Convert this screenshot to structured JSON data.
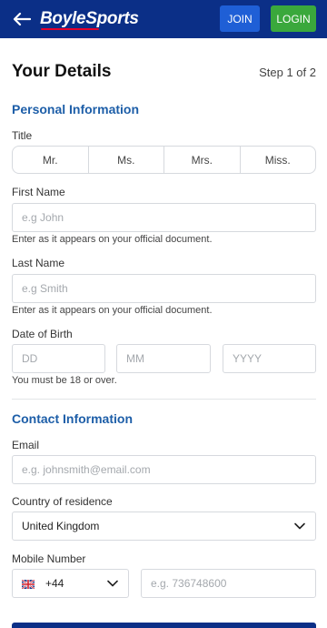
{
  "header": {
    "brand": "BoyleSports",
    "join_label": "JOIN",
    "login_label": "LOGIN",
    "colors": {
      "bar": "#0b2f87",
      "join": "#1f5fd6",
      "login": "#3aa83c",
      "accent": "#e4002b"
    }
  },
  "page": {
    "title": "Your Details",
    "step": "Step 1 of 2"
  },
  "personal": {
    "section_title": "Personal Information",
    "title_label": "Title",
    "title_options": [
      "Mr.",
      "Ms.",
      "Mrs.",
      "Miss."
    ],
    "first_name_label": "First Name",
    "first_name_placeholder": "e.g John",
    "first_name_hint": "Enter as it appears on your official document.",
    "last_name_label": "Last Name",
    "last_name_placeholder": "e.g Smith",
    "last_name_hint": "Enter as it appears on your official document.",
    "dob_label": "Date of Birth",
    "dob_day_placeholder": "DD",
    "dob_month_placeholder": "MM",
    "dob_year_placeholder": "YYYY",
    "dob_hint": "You must be 18 or over."
  },
  "contact": {
    "section_title": "Contact Information",
    "email_label": "Email",
    "email_placeholder": "e.g. johnsmith@email.com",
    "country_label": "Country of residence",
    "country_value": "United Kingdom",
    "mobile_label": "Mobile Number",
    "mobile_code": "+44",
    "mobile_placeholder": "e.g. 736748600"
  },
  "icons": {
    "back": "arrow-left-icon",
    "chevron": "chevron-down-icon",
    "flag": "uk-flag-icon"
  }
}
